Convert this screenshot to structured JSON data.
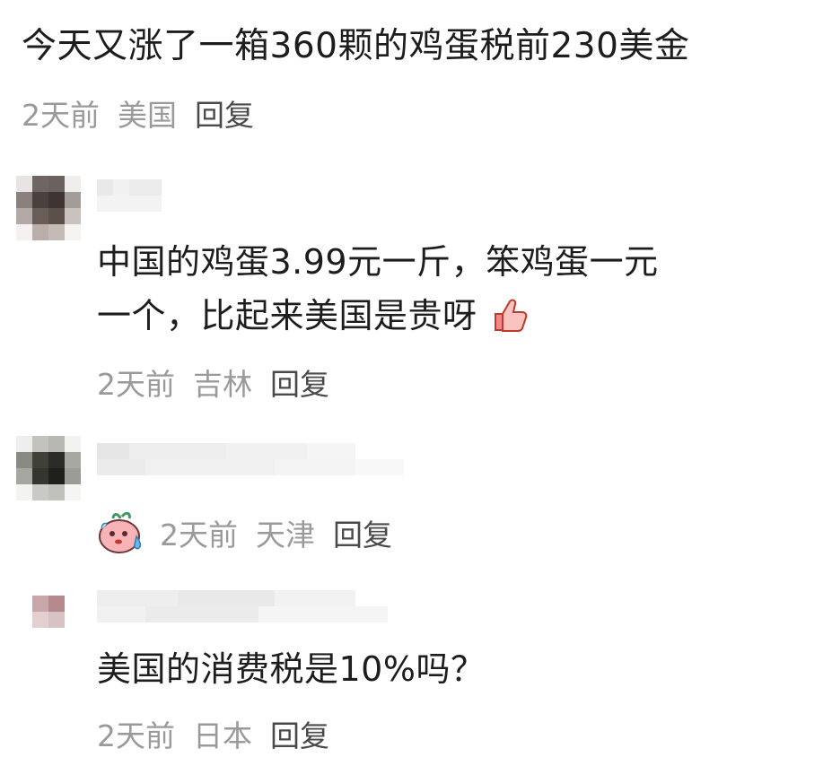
{
  "post": {
    "text": "今天又涨了一箱360颗的鸡蛋税前230美金",
    "time": "2天前",
    "location": "美国",
    "reply": "回复"
  },
  "comments": [
    {
      "line1": "中国的鸡蛋3.99元一斤，笨鸡蛋一元",
      "line2": "一个，比起来美国是贵呀",
      "emoji": "thumbs-up-emoji",
      "time": "2天前",
      "location": "吉林",
      "reply": "回复"
    },
    {
      "sticker": "sweating-pink-blob-sticker",
      "time": "2天前",
      "location": "天津",
      "reply": "回复"
    },
    {
      "text": "美国的消费税是10%吗？",
      "time": "2天前",
      "location": "日本",
      "reply": "回复"
    }
  ]
}
